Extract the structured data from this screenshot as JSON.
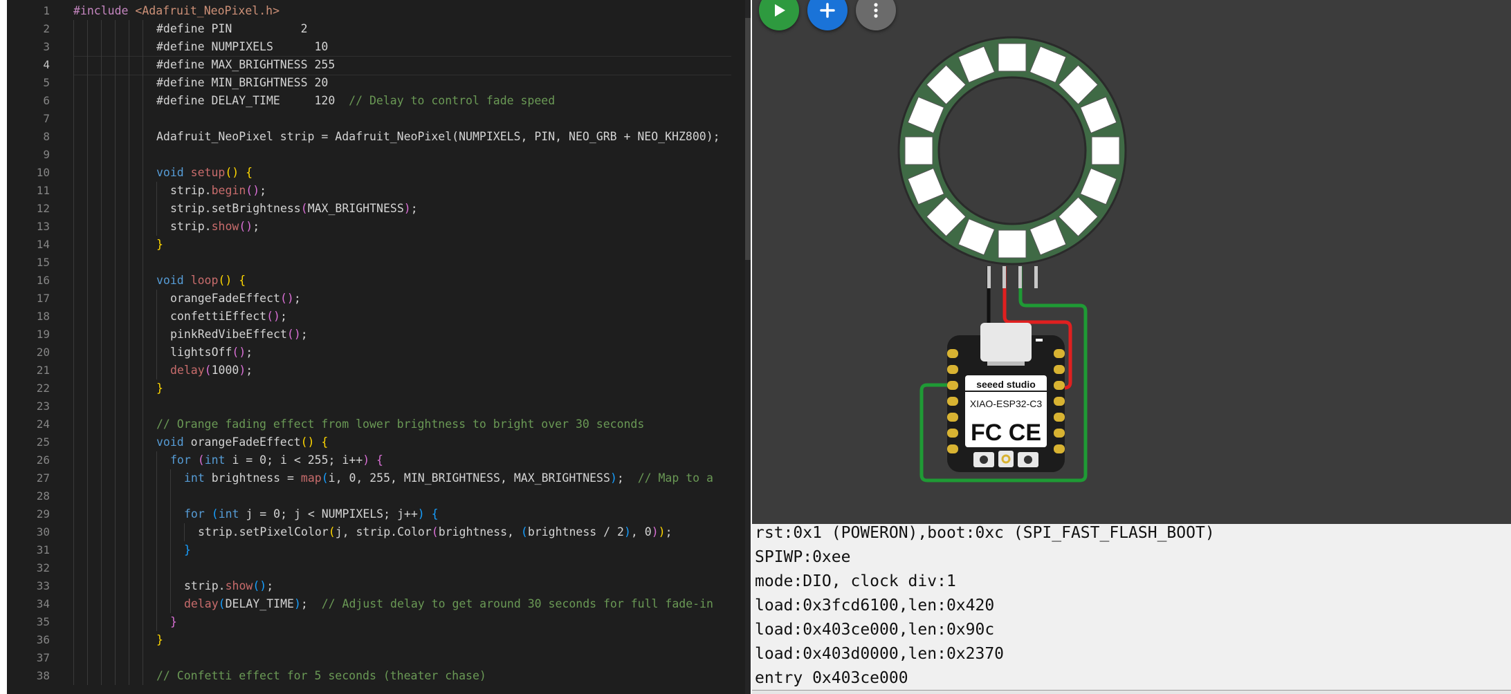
{
  "editor": {
    "line_numbers": [
      "1",
      "2",
      "3",
      "4",
      "5",
      "6",
      "7",
      "8",
      "9",
      "10",
      "11",
      "12",
      "13",
      "14",
      "15",
      "16",
      "17",
      "18",
      "19",
      "20",
      "21",
      "22",
      "23",
      "24",
      "25",
      "26",
      "27",
      "28",
      "29",
      "30",
      "31",
      "32",
      "33",
      "34",
      "35",
      "36",
      "37",
      "38"
    ],
    "active_line_index": 3,
    "lines": [
      {
        "indent": 0,
        "tokens": [
          {
            "c": "pp",
            "t": "#include "
          },
          {
            "c": "inc",
            "t": "<Adafruit_NeoPixel.h>"
          }
        ]
      },
      {
        "indent": 6,
        "tokens": [
          {
            "c": "",
            "t": "#define PIN          2"
          }
        ]
      },
      {
        "indent": 6,
        "tokens": [
          {
            "c": "",
            "t": "#define NUMPIXELS      10"
          }
        ]
      },
      {
        "indent": 6,
        "tokens": [
          {
            "c": "",
            "t": "#define MAX_BRIGHTNESS 255"
          }
        ]
      },
      {
        "indent": 6,
        "tokens": [
          {
            "c": "",
            "t": "#define MIN_BRIGHTNESS 20"
          }
        ]
      },
      {
        "indent": 6,
        "tokens": [
          {
            "c": "",
            "t": "#define DELAY_TIME     120  "
          },
          {
            "c": "cm",
            "t": "// Delay to control fade speed"
          }
        ]
      },
      {
        "indent": 6,
        "tokens": []
      },
      {
        "indent": 6,
        "tokens": [
          {
            "c": "",
            "t": "Adafruit_NeoPixel strip = Adafruit_NeoPixel(NUMPIXELS, PIN, NEO_GRB + NEO_KHZ800);"
          }
        ]
      },
      {
        "indent": 6,
        "tokens": []
      },
      {
        "indent": 6,
        "tokens": [
          {
            "c": "kw",
            "t": "void "
          },
          {
            "c": "fn",
            "t": "setup"
          },
          {
            "c": "br1",
            "t": "() {"
          }
        ]
      },
      {
        "indent": 7,
        "tokens": [
          {
            "c": "",
            "t": "strip."
          },
          {
            "c": "fn",
            "t": "begin"
          },
          {
            "c": "br2",
            "t": "()"
          },
          {
            "c": "",
            "t": ";"
          }
        ]
      },
      {
        "indent": 7,
        "tokens": [
          {
            "c": "",
            "t": "strip.setBrightness"
          },
          {
            "c": "br2",
            "t": "("
          },
          {
            "c": "",
            "t": "MAX_BRIGHTNESS"
          },
          {
            "c": "br2",
            "t": ")"
          },
          {
            "c": "",
            "t": ";"
          }
        ]
      },
      {
        "indent": 7,
        "tokens": [
          {
            "c": "",
            "t": "strip."
          },
          {
            "c": "fn",
            "t": "show"
          },
          {
            "c": "br2",
            "t": "()"
          },
          {
            "c": "",
            "t": ";"
          }
        ]
      },
      {
        "indent": 6,
        "tokens": [
          {
            "c": "br1",
            "t": "}"
          }
        ]
      },
      {
        "indent": 6,
        "tokens": []
      },
      {
        "indent": 6,
        "tokens": [
          {
            "c": "kw",
            "t": "void "
          },
          {
            "c": "fn",
            "t": "loop"
          },
          {
            "c": "br1",
            "t": "() {"
          }
        ]
      },
      {
        "indent": 7,
        "tokens": [
          {
            "c": "",
            "t": "orangeFadeEffect"
          },
          {
            "c": "br2",
            "t": "()"
          },
          {
            "c": "",
            "t": ";"
          }
        ]
      },
      {
        "indent": 7,
        "tokens": [
          {
            "c": "",
            "t": "confettiEffect"
          },
          {
            "c": "br2",
            "t": "()"
          },
          {
            "c": "",
            "t": ";"
          }
        ]
      },
      {
        "indent": 7,
        "tokens": [
          {
            "c": "",
            "t": "pinkRedVibeEffect"
          },
          {
            "c": "br2",
            "t": "()"
          },
          {
            "c": "",
            "t": ";"
          }
        ]
      },
      {
        "indent": 7,
        "tokens": [
          {
            "c": "",
            "t": "lightsOff"
          },
          {
            "c": "br2",
            "t": "()"
          },
          {
            "c": "",
            "t": ";"
          }
        ]
      },
      {
        "indent": 7,
        "tokens": [
          {
            "c": "fn",
            "t": "delay"
          },
          {
            "c": "br2",
            "t": "("
          },
          {
            "c": "",
            "t": "1000"
          },
          {
            "c": "br2",
            "t": ")"
          },
          {
            "c": "",
            "t": ";"
          }
        ]
      },
      {
        "indent": 6,
        "tokens": [
          {
            "c": "br1",
            "t": "}"
          }
        ]
      },
      {
        "indent": 6,
        "tokens": []
      },
      {
        "indent": 6,
        "tokens": [
          {
            "c": "cm",
            "t": "// Orange fading effect from lower brightness to bright over 30 seconds"
          }
        ]
      },
      {
        "indent": 6,
        "tokens": [
          {
            "c": "kw",
            "t": "void "
          },
          {
            "c": "",
            "t": "orangeFadeEffect"
          },
          {
            "c": "br1",
            "t": "() {"
          }
        ]
      },
      {
        "indent": 7,
        "tokens": [
          {
            "c": "kw",
            "t": "for "
          },
          {
            "c": "br2",
            "t": "("
          },
          {
            "c": "kw",
            "t": "int "
          },
          {
            "c": "",
            "t": "i = 0; i < 255; i++"
          },
          {
            "c": "br2",
            "t": ") {"
          }
        ]
      },
      {
        "indent": 8,
        "tokens": [
          {
            "c": "kw",
            "t": "int "
          },
          {
            "c": "",
            "t": "brightness = "
          },
          {
            "c": "fn",
            "t": "map"
          },
          {
            "c": "br3",
            "t": "("
          },
          {
            "c": "",
            "t": "i, 0, 255, MIN_BRIGHTNESS, MAX_BRIGHTNESS"
          },
          {
            "c": "br3",
            "t": ")"
          },
          {
            "c": "",
            "t": ";  "
          },
          {
            "c": "cm",
            "t": "// Map to a"
          }
        ]
      },
      {
        "indent": 8,
        "tokens": []
      },
      {
        "indent": 8,
        "tokens": [
          {
            "c": "kw",
            "t": "for "
          },
          {
            "c": "br3",
            "t": "("
          },
          {
            "c": "kw",
            "t": "int "
          },
          {
            "c": "",
            "t": "j = 0; j < NUMPIXELS; j++"
          },
          {
            "c": "br3",
            "t": ") {"
          }
        ]
      },
      {
        "indent": 9,
        "tokens": [
          {
            "c": "",
            "t": "strip.setPixelColor"
          },
          {
            "c": "br1",
            "t": "("
          },
          {
            "c": "",
            "t": "j, strip.Color"
          },
          {
            "c": "br2",
            "t": "("
          },
          {
            "c": "",
            "t": "brightness, "
          },
          {
            "c": "br3",
            "t": "("
          },
          {
            "c": "",
            "t": "brightness / 2"
          },
          {
            "c": "br3",
            "t": ")"
          },
          {
            "c": "",
            "t": ", 0"
          },
          {
            "c": "br2",
            "t": ")"
          },
          {
            "c": "br1",
            "t": ")"
          },
          {
            "c": "",
            "t": ";"
          }
        ]
      },
      {
        "indent": 8,
        "tokens": [
          {
            "c": "br3",
            "t": "}"
          }
        ]
      },
      {
        "indent": 8,
        "tokens": []
      },
      {
        "indent": 8,
        "tokens": [
          {
            "c": "",
            "t": "strip."
          },
          {
            "c": "fn",
            "t": "show"
          },
          {
            "c": "br3",
            "t": "()"
          },
          {
            "c": "",
            "t": ";"
          }
        ]
      },
      {
        "indent": 8,
        "tokens": [
          {
            "c": "fn",
            "t": "delay"
          },
          {
            "c": "br3",
            "t": "("
          },
          {
            "c": "",
            "t": "DELAY_TIME"
          },
          {
            "c": "br3",
            "t": ")"
          },
          {
            "c": "",
            "t": ";  "
          },
          {
            "c": "cm",
            "t": "// Adjust delay to get around 30 seconds for full fade-in"
          }
        ]
      },
      {
        "indent": 7,
        "tokens": [
          {
            "c": "br2",
            "t": "}"
          }
        ]
      },
      {
        "indent": 6,
        "tokens": [
          {
            "c": "br1",
            "t": "}"
          }
        ]
      },
      {
        "indent": 6,
        "tokens": []
      },
      {
        "indent": 6,
        "tokens": [
          {
            "c": "cm",
            "t": "// Confetti effect for 5 seconds (theater chase)"
          }
        ]
      }
    ]
  },
  "simulator": {
    "buttons": [
      {
        "name": "play-button",
        "icon": "play-icon",
        "color": "#2e9a3f"
      },
      {
        "name": "add-part-button",
        "icon": "plus-icon",
        "color": "#1a73d8"
      },
      {
        "name": "more-options-button",
        "icon": "more-vert-icon",
        "color": "#6b6b6b"
      }
    ],
    "neopixel_ring": {
      "led_count": 16,
      "ring_color": "#3f6a45",
      "led_color": "#ffffff"
    },
    "board": {
      "brand": "seeed studio",
      "model": "XIAO-ESP32-C3",
      "cert_marks": "FC CE"
    },
    "wire_colors": {
      "gnd": "#111111",
      "vcc": "#e02020",
      "din": "#1f9a35"
    }
  },
  "serial_monitor": {
    "lines": [
      "rst:0x1 (POWERON),boot:0xc (SPI_FAST_FLASH_BOOT)",
      "SPIWP:0xee",
      "mode:DIO, clock div:1",
      "load:0x3fcd6100,len:0x420",
      "load:0x403ce000,len:0x90c",
      "load:0x403d0000,len:0x2370",
      "entry 0x403ce000"
    ]
  }
}
